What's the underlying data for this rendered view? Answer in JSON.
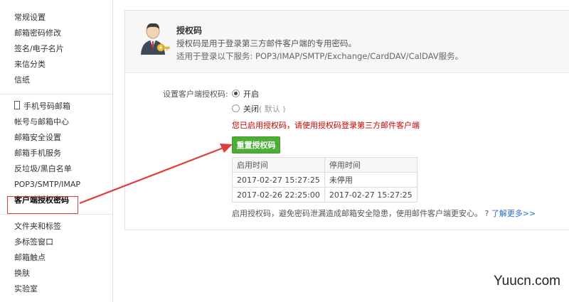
{
  "sidebar": {
    "group1": [
      "常规设置",
      "邮箱密码修改",
      "签名/电子名片",
      "来信分类",
      "信纸"
    ],
    "group2": [
      "手机号码邮箱",
      "帐号与邮箱中心",
      "邮箱安全设置",
      "邮箱手机服务",
      "反垃圾/黑白名单",
      "POP3/SMTP/IMAP",
      "客户端授权密码"
    ],
    "group3": [
      "文件夹和标签",
      "多标签窗口",
      "邮箱触点",
      "换肤",
      "实验室"
    ],
    "active": "客户端授权密码"
  },
  "header": {
    "title": "授权码",
    "desc": "授权码是用于登录第三方邮件客户端的专用密码。",
    "services": "适用于登录以下服务: POP3/IMAP/SMTP/Exchange/CardDAV/CalDAV服务。"
  },
  "settings": {
    "label": "设置客户端授权码:",
    "option_on": "开启",
    "option_off": "关闭",
    "option_off_note": "( 默认 )",
    "selected": "开启",
    "warning": "您已启用授权码，请使用授权码登录第三方邮件客户端",
    "reset_button": "重置授权码"
  },
  "table": {
    "headers": [
      "启用时间",
      "停用时间"
    ],
    "rows": [
      [
        "2017-02-27 15:27:25",
        "未停用"
      ],
      [
        "2017-02-26 22:25:00",
        "2017-02-27 15:27:25"
      ]
    ]
  },
  "footer": {
    "text": "启用授权码，避免密码泄漏造成邮箱安全隐患，使用邮件客户端更安心。",
    "link": "了解更多>>"
  },
  "annotation": {
    "color": "#e23b3b"
  },
  "watermark": "Yuucn.com"
}
